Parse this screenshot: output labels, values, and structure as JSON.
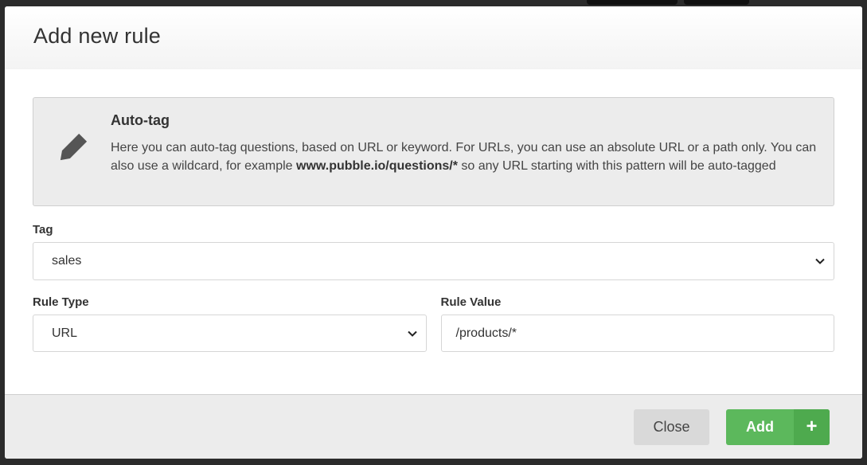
{
  "modal": {
    "title": "Add new rule"
  },
  "info": {
    "icon": "tag-icon",
    "title": "Auto-tag",
    "text_before": "Here you can auto-tag questions, based on URL or keyword. For URLs, you can use an absolute URL or a path only. You can also use a wildcard, for example ",
    "example": "www.pubble.io/questions/*",
    "text_after": " so any URL starting with this pattern will be auto-tagged"
  },
  "form": {
    "tag_label": "Tag",
    "tag_value": "sales",
    "rule_type_label": "Rule Type",
    "rule_type_value": "URL",
    "rule_value_label": "Rule Value",
    "rule_value_value": "/products/*"
  },
  "footer": {
    "close_label": "Close",
    "add_label": "Add",
    "add_icon": "+"
  },
  "colors": {
    "primary_green": "#5cb85c",
    "footer_bg": "#ececec"
  }
}
